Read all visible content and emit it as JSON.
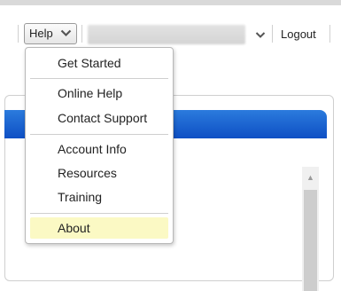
{
  "header": {
    "help_label": "Help",
    "logout_label": "Logout"
  },
  "help_menu": {
    "items": [
      {
        "label": "Get Started"
      },
      {
        "label": "Online Help"
      },
      {
        "label": "Contact Support"
      },
      {
        "label": "Account Info"
      },
      {
        "label": "Resources"
      },
      {
        "label": "Training"
      },
      {
        "label": "About",
        "selected": true
      }
    ]
  },
  "colors": {
    "panel_header": "#1a5fd0",
    "selected_item": "#fbf9c4"
  },
  "icons": {
    "help_chevron": "chevron-down-icon",
    "account_chevron": "chevron-down-icon",
    "scroll_up": "scroll-up-arrow-icon"
  }
}
